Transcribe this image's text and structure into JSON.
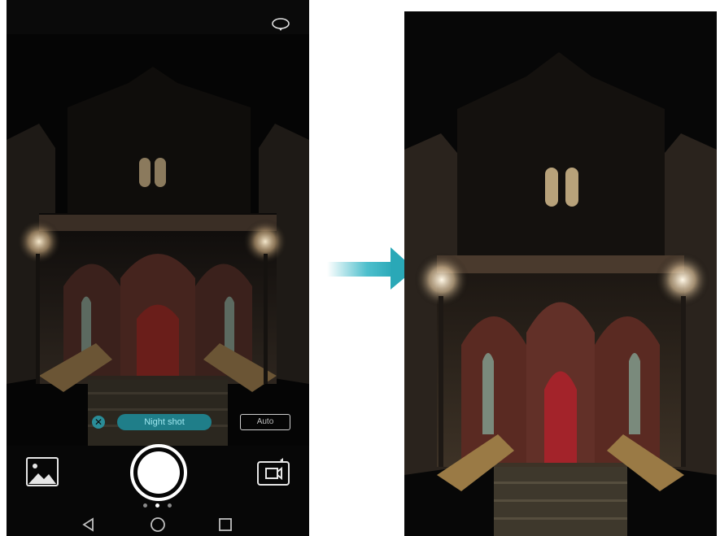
{
  "camera": {
    "mode_label": "Night shot",
    "flash_label": "Auto",
    "close_symbol": "✕",
    "icons": {
      "rotate": "rotate-icon",
      "gallery": "gallery-icon",
      "shutter": "shutter-icon",
      "switch_camera": "switch-camera-icon",
      "back": "back-icon",
      "home": "home-icon",
      "recent": "recent-apps-icon"
    }
  },
  "colors": {
    "accent": "#1f7e89",
    "arrow": "#3ab8c7"
  }
}
